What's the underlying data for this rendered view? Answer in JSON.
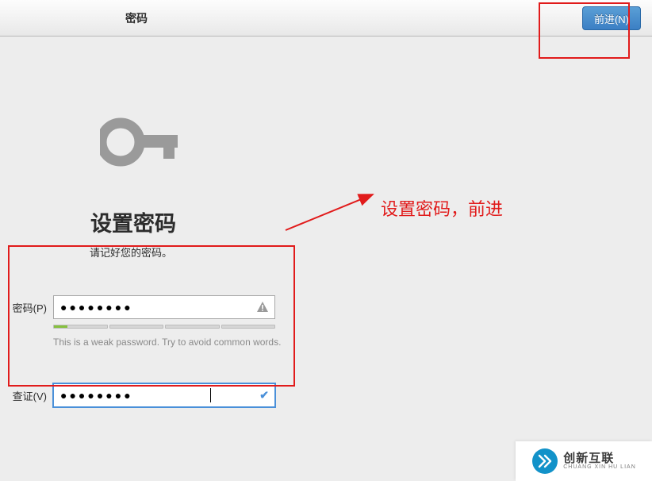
{
  "header": {
    "title": "密码",
    "next_button": "前进(N)"
  },
  "page": {
    "title": "设置密码",
    "subtitle": "请记好您的密码。"
  },
  "form": {
    "password_label": "密码(P)",
    "verify_label": "查证(V)",
    "password_value": "●●●●●●●●",
    "verify_value": "●●●●●●●●",
    "hint": "This is a weak password. Try to avoid common words."
  },
  "annotation": {
    "text": "设置密码，前进"
  },
  "watermark": {
    "cn": "创新互联",
    "en": "CHUANG XIN HU LIAN"
  }
}
